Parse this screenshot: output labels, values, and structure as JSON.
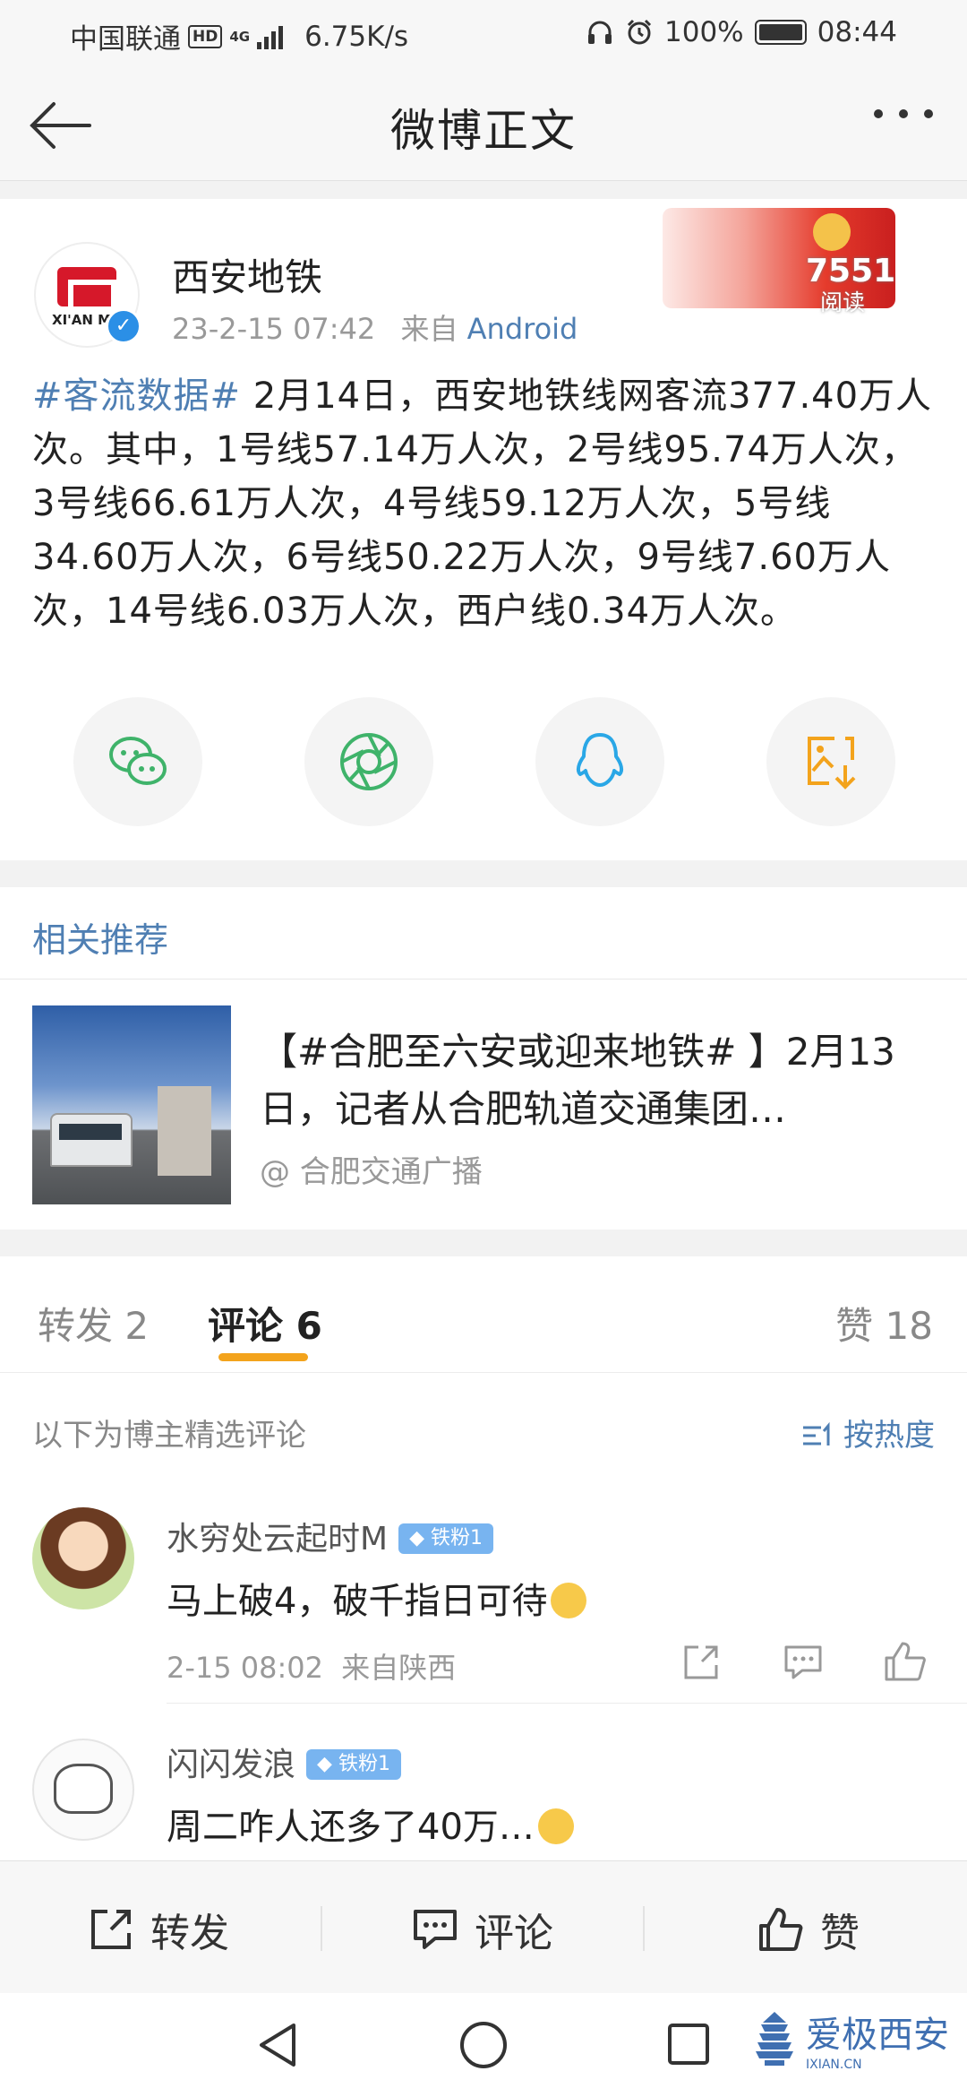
{
  "status_bar": {
    "carrier": "中国联通",
    "hd": "HD",
    "network": "4G",
    "speed": "6.75K/s",
    "battery": "100%",
    "time": "08:44"
  },
  "nav": {
    "title": "微博正文"
  },
  "post": {
    "author": "西安地铁",
    "avatar_text": "XI'AN MET",
    "timestamp": "23-2-15 07:42",
    "source_prefix": "来自",
    "source": "Android",
    "read_count": "7551",
    "read_label": "阅读",
    "hashtag": "#客流数据#",
    "body": " 2月14日，西安地铁线网客流377.40万人次。其中，1号线57.14万人次，2号线95.74万人次，3号线66.61万人次，4号线59.12万人次，5号线34.60万人次，6号线50.22万人次，9号线7.60万人次，14号线6.03万人次，西户线0.34万人次。"
  },
  "share_icons": [
    "wechat-icon",
    "moments-icon",
    "qq-icon",
    "save-image-icon"
  ],
  "related": {
    "heading": "相关推荐",
    "items": [
      {
        "title": "【#合肥至六安或迎来地铁# 】2月13日，记者从合肥轨道交通集团…",
        "author": "@ 合肥交通广播"
      }
    ]
  },
  "comments_section": {
    "tabs": [
      {
        "label": "转发",
        "count": "2"
      },
      {
        "label": "评论",
        "count": "6"
      },
      {
        "label": "赞",
        "count": "18"
      }
    ],
    "selected_tab": "评论",
    "note": "以下为博主精选评论",
    "sort_label": "按热度",
    "comments": [
      {
        "name": "水穷处云起时M",
        "badge": "铁粉1",
        "text": "马上破4，破千指日可待",
        "time": "2-15 08:02",
        "location": "来自陕西"
      },
      {
        "name": "闪闪发浪",
        "badge": "铁粉1",
        "text": "周二咋人还多了40万…"
      }
    ]
  },
  "actions": {
    "repost": "转发",
    "comment": "评论",
    "like": "赞"
  },
  "watermark": {
    "text": "爱极西安",
    "url": "IXIAN.CN"
  },
  "colors": {
    "link": "#4f7fb3",
    "tab_underline": "#f3a31c",
    "brand_red": "#d6182a",
    "fan_badge": "#78b4f0"
  }
}
